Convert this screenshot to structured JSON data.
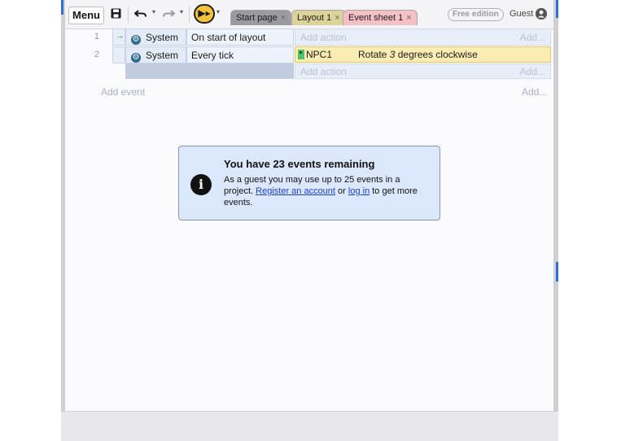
{
  "toolbar": {
    "menu_label": "Menu",
    "save_icon": "floppy-disk-icon",
    "undo_icon": "undo-icon",
    "redo_icon": "redo-icon",
    "play_icon": "preview-play-icon"
  },
  "tabs": [
    {
      "label": "Start page",
      "close": "×"
    },
    {
      "label": "Layout 1",
      "close": "×"
    },
    {
      "label": "Event sheet 1",
      "close": "×"
    }
  ],
  "account": {
    "edition_badge": "Free edition",
    "user_label": "Guest"
  },
  "events": [
    {
      "number": "1",
      "trigger_icon": "→",
      "object": "System",
      "condition": "On start of layout",
      "add_action": "Add action",
      "add_right": "Add..."
    },
    {
      "number": "2",
      "object": "System",
      "condition": "Every tick",
      "action_object": "NPC1",
      "action_text_before": "Rotate ",
      "action_value": "3",
      "action_text_after": " degrees clockwise",
      "add_action": "Add action",
      "add_right": "Add..."
    }
  ],
  "sheet": {
    "add_event": "Add event",
    "add_right": "Add..."
  },
  "dialog": {
    "title": "You have 23 events remaining",
    "body_1": "As a guest you may use up to 25 events in a project. ",
    "link_register": "Register an account",
    "body_2": " or ",
    "link_login": "log in",
    "body_3": " to get more events."
  },
  "colors": {
    "accent_blue": "#2f6fd6",
    "play_button": "#f5c33b",
    "action_highlight": "#faedb3",
    "dialog_background": "#dbe8fb"
  }
}
